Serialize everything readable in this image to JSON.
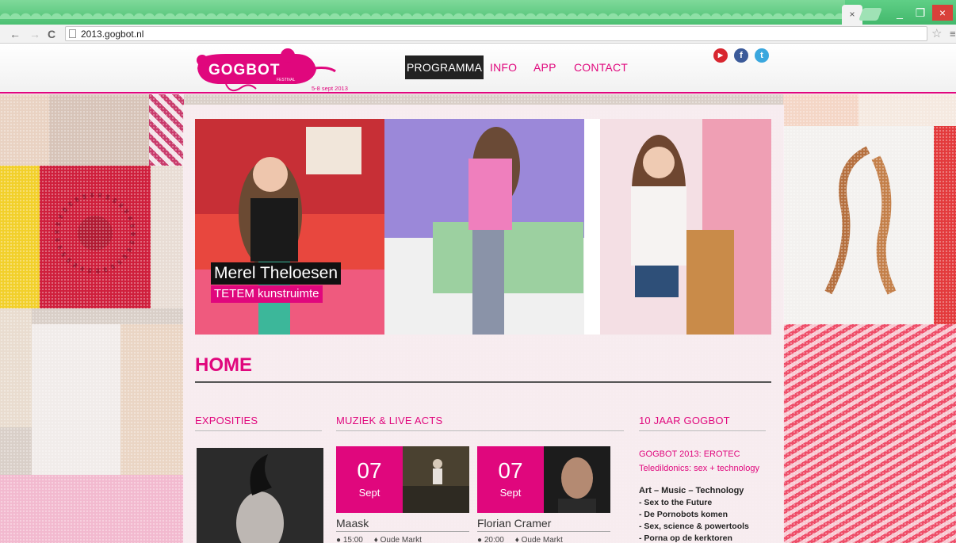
{
  "browser": {
    "tab_close": "×",
    "url": "2013.gogbot.nl",
    "window_controls": {
      "minimize": "_",
      "maximize": "❐",
      "close": "×"
    },
    "nav": {
      "back": "←",
      "forward": "→",
      "reload": "C"
    },
    "star": "☆",
    "menu": "≡"
  },
  "site": {
    "logo": {
      "text": "GOGBOT",
      "sub": "FESTIVAL",
      "dates": "5-8 sept 2013"
    },
    "nav": [
      {
        "label": "PROGRAMMA",
        "active": true
      },
      {
        "label": "INFO",
        "active": false
      },
      {
        "label": "APP",
        "active": false
      },
      {
        "label": "CONTACT",
        "active": false
      }
    ],
    "social": [
      {
        "name": "youtube-icon",
        "glyph": "▶"
      },
      {
        "name": "facebook-icon",
        "glyph": "f"
      },
      {
        "name": "twitter-icon",
        "glyph": "t"
      }
    ],
    "colors": {
      "accent": "#e0077d",
      "nav_active_bg": "#222222"
    }
  },
  "slideshow": {
    "caption_name": "Merel Theloesen",
    "caption_venue": "TETEM kunstruimte"
  },
  "home": {
    "title": "HOME",
    "columns": {
      "expo": "EXPOSITIES",
      "music": "MUZIEK & LIVE ACTS",
      "gogbot": "10 JAAR GOGBOT"
    },
    "events": [
      {
        "day": "07",
        "month": "Sept",
        "name": "Maask",
        "time": "15:00",
        "location": "Oude Markt"
      },
      {
        "day": "07",
        "month": "Sept",
        "name": "Florian Cramer",
        "time": "20:00",
        "location": "Oude Markt"
      }
    ],
    "gogbot": {
      "subtitle1": "GOGBOT 2013: EROTEC",
      "subtitle2": "Teledildonics: sex + technology",
      "heading": "Art – Music – Technology",
      "items": [
        "- Sex to the Future",
        "- De Pornobots komen",
        "- Sex, science & powertools",
        "- Porna op de kerktoren"
      ]
    }
  }
}
